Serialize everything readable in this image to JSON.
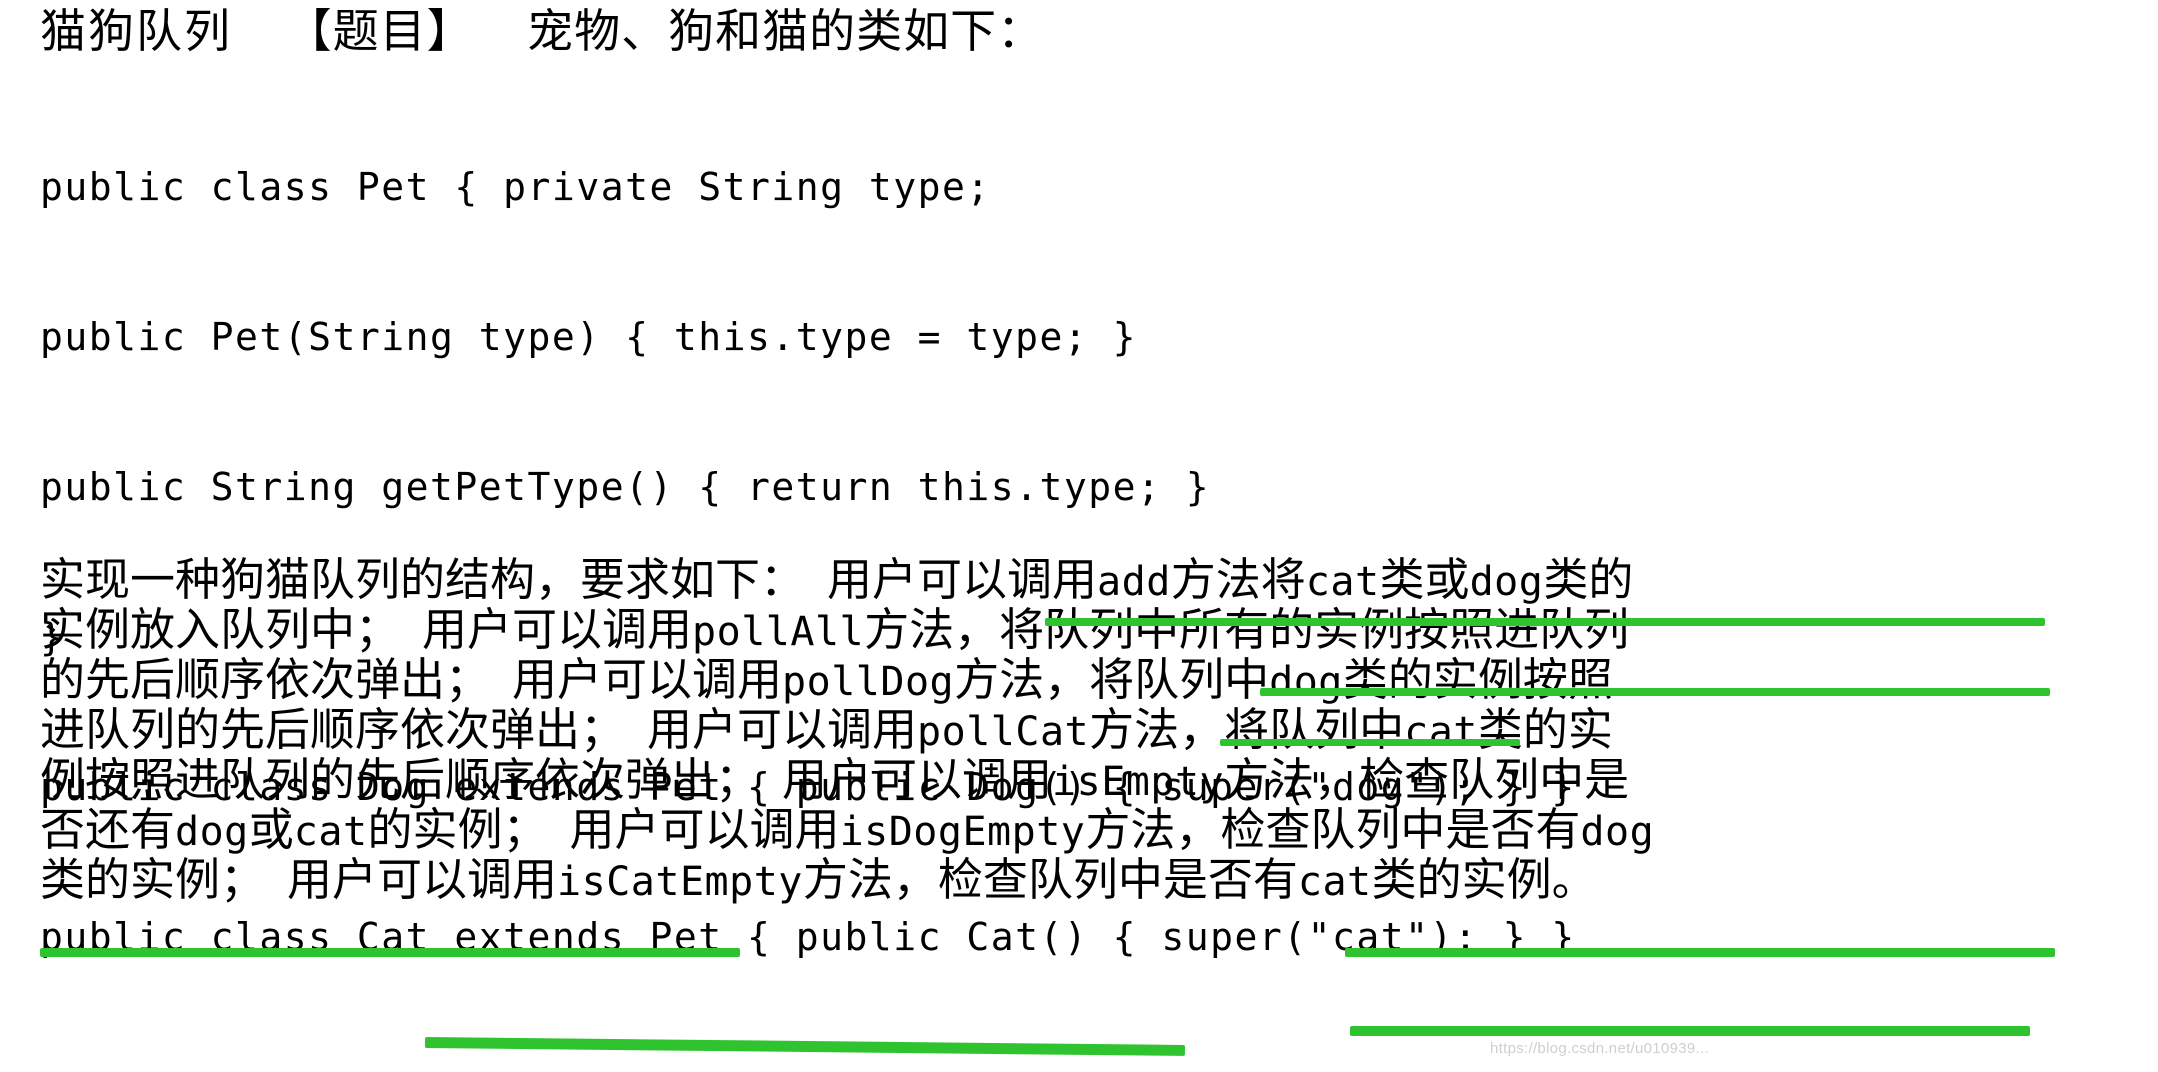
{
  "document": {
    "title_line": {
      "heading": "猫狗队列",
      "bracket_label": "【题目】",
      "intro": "宠物、狗和猫的类如下："
    },
    "code_block": {
      "language": "java",
      "lines": [
        "public class Pet { private String type;",
        "public Pet(String type) { this.type = type; }",
        "public String getPetType() { return this.type; }",
        "}",
        "public class Dog extends Pet { public Dog() { super(\"dog\"); } }",
        "public class Cat extends Pet { public Cat() { super(\"cat\"); } }"
      ]
    },
    "body_paragraph": {
      "lines": [
        {
          "id": "line-1",
          "text": "实现一种狗猫队列的结构，要求如下： 用户可以调用add方法将cat类或dog类的",
          "segments": [
            {
              "kind": "cjk",
              "text": "实现一种狗猫队列的结构，要求如下："
            },
            {
              "kind": "gap",
              "text": " "
            },
            {
              "kind": "cjk",
              "text": "用户可以调用"
            },
            {
              "kind": "mono",
              "text": "add"
            },
            {
              "kind": "cjk",
              "text": "方法将"
            },
            {
              "kind": "mono",
              "text": "cat"
            },
            {
              "kind": "cjk",
              "text": "类或"
            },
            {
              "kind": "mono",
              "text": "dog"
            },
            {
              "kind": "cjk",
              "text": "类的"
            }
          ]
        },
        {
          "id": "line-2",
          "text": "实例放入队列中； 用户可以调用pollAll方法，将队列中所有的实例按照进队列",
          "segments": [
            {
              "kind": "cjk",
              "text": "实例放入队列中；"
            },
            {
              "kind": "gap",
              "text": " "
            },
            {
              "kind": "cjk",
              "text": "用户可以调用"
            },
            {
              "kind": "mono",
              "text": "pollAll"
            },
            {
              "kind": "cjk",
              "text": "方法，将队列中所有的实例按照进队列"
            }
          ]
        },
        {
          "id": "line-3",
          "text": "的先后顺序依次弹出； 用户可以调用pollDog方法，将队列中dog类的实例按照",
          "segments": [
            {
              "kind": "cjk",
              "text": "的先后顺序依次弹出；"
            },
            {
              "kind": "gap",
              "text": " "
            },
            {
              "kind": "cjk",
              "text": "用户可以调用"
            },
            {
              "kind": "mono",
              "text": "pollDog"
            },
            {
              "kind": "cjk",
              "text": "方法，将队列中"
            },
            {
              "kind": "mono",
              "text": "dog"
            },
            {
              "kind": "cjk",
              "text": "类的实例按照"
            }
          ]
        },
        {
          "id": "line-4",
          "text": "进队列的先后顺序依次弹出； 用户可以调用pollCat方法，将队列中cat类的实",
          "segments": [
            {
              "kind": "cjk",
              "text": "进队列的先后顺序依次弹出；"
            },
            {
              "kind": "gap",
              "text": " "
            },
            {
              "kind": "cjk",
              "text": "用户可以调用"
            },
            {
              "kind": "mono",
              "text": "pollCat"
            },
            {
              "kind": "cjk",
              "text": "方法，将队列中"
            },
            {
              "kind": "mono",
              "text": "cat"
            },
            {
              "kind": "cjk",
              "text": "类的实"
            }
          ]
        },
        {
          "id": "line-5",
          "text": "例按照进队列的先后顺序依次弹出； 用户可以调用isEmpty方法，检查队列中是",
          "segments": [
            {
              "kind": "cjk",
              "text": "例按照进队列的先后顺序依次弹出；"
            },
            {
              "kind": "gap",
              "text": " "
            },
            {
              "kind": "cjk",
              "text": "用户可以调用"
            },
            {
              "kind": "mono",
              "text": "isEmpty"
            },
            {
              "kind": "cjk",
              "text": "方法，检查队列中是"
            }
          ]
        },
        {
          "id": "line-6",
          "text": "否还有dog或cat的实例； 用户可以调用isDogEmpty方法，检查队列中是否有dog",
          "segments": [
            {
              "kind": "cjk",
              "text": "否还有"
            },
            {
              "kind": "mono",
              "text": "dog"
            },
            {
              "kind": "cjk",
              "text": "或"
            },
            {
              "kind": "mono",
              "text": "cat"
            },
            {
              "kind": "cjk",
              "text": "的实例；"
            },
            {
              "kind": "gap",
              "text": " "
            },
            {
              "kind": "cjk",
              "text": "用户可以调用"
            },
            {
              "kind": "mono",
              "text": "isDogEmpty"
            },
            {
              "kind": "cjk",
              "text": "方法，检查队列中是否有"
            },
            {
              "kind": "mono",
              "text": "dog"
            }
          ]
        },
        {
          "id": "line-7",
          "text": "类的实例； 用户可以调用isCatEmpty方法，检查队列中是否有cat类的实例。",
          "segments": [
            {
              "kind": "cjk",
              "text": "类的实例；"
            },
            {
              "kind": "gap",
              "text": " "
            },
            {
              "kind": "cjk",
              "text": "用户可以调用"
            },
            {
              "kind": "mono",
              "text": "isCatEmpty"
            },
            {
              "kind": "cjk",
              "text": "方法，检查队列中是否有"
            },
            {
              "kind": "mono",
              "text": "cat"
            },
            {
              "kind": "cjk",
              "text": "类的实例。"
            }
          ]
        }
      ]
    },
    "annotations": {
      "color": "#2fc42f",
      "style": "green-highlighter-underline",
      "marks": [
        {
          "id": "mark-1",
          "covers": "用户可以调用add方法将cat类或dog类的"
        },
        {
          "id": "mark-2",
          "covers": "将队列中所有的实例按照进队列"
        },
        {
          "id": "mark-3",
          "covers": "将队列"
        },
        {
          "id": "mark-4",
          "covers": "否还有dog或cat的"
        },
        {
          "id": "mark-5",
          "covers": "检查队列中是否有dog"
        },
        {
          "id": "mark-6",
          "covers": "用户可以调用isCatEmpty方法"
        },
        {
          "id": "mark-7",
          "covers": "检查队列中是否有cat类的实例"
        }
      ]
    },
    "watermark": {
      "text": "https://blog.csdn.net/u010939..."
    }
  }
}
